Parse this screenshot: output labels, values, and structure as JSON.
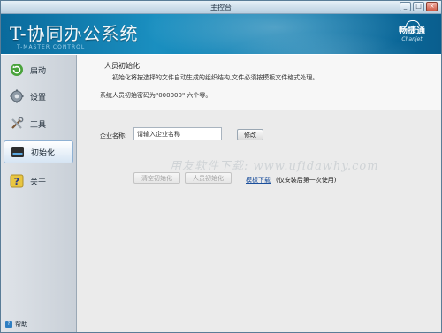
{
  "window": {
    "title": "主控台",
    "controls": {
      "minimize": "_",
      "maximize": "□",
      "close": "×"
    }
  },
  "banner": {
    "app_name": "T-协同办公系统",
    "app_sub": "T-MASTER CONTROL",
    "brand_name": "畅捷通",
    "brand_sub": "Chanjet"
  },
  "sidebar": {
    "items": [
      {
        "label": "启动",
        "icon": "refresh-icon",
        "active": false
      },
      {
        "label": "设置",
        "icon": "gear-icon",
        "active": false
      },
      {
        "label": "工具",
        "icon": "tools-icon",
        "active": false
      },
      {
        "label": "初始化",
        "icon": "start-icon",
        "active": true
      },
      {
        "label": "关于",
        "icon": "question-icon",
        "active": false
      }
    ],
    "help_label": "帮助"
  },
  "init": {
    "heading": "人员初始化",
    "description": "初始化将按选择的文件自动生成的组织结构,文件必须按模板文件格式处理。",
    "password_note": "系统人员初始密码为\"000000\" 六个零。",
    "company_label": "企业名称:",
    "company_value": "请输入企业名称",
    "modify_label": "修改",
    "clear_label": "清空初始化",
    "init_label": "人员初始化",
    "template_link": "模板下载",
    "template_note": "(仅安装后第一次使用)"
  },
  "watermark": "用友软件下载: www.ufidawhy.com",
  "colors": {
    "banner": "#0c79ad",
    "link": "#1b4f9c",
    "active_nav": "#d5e4f3"
  }
}
